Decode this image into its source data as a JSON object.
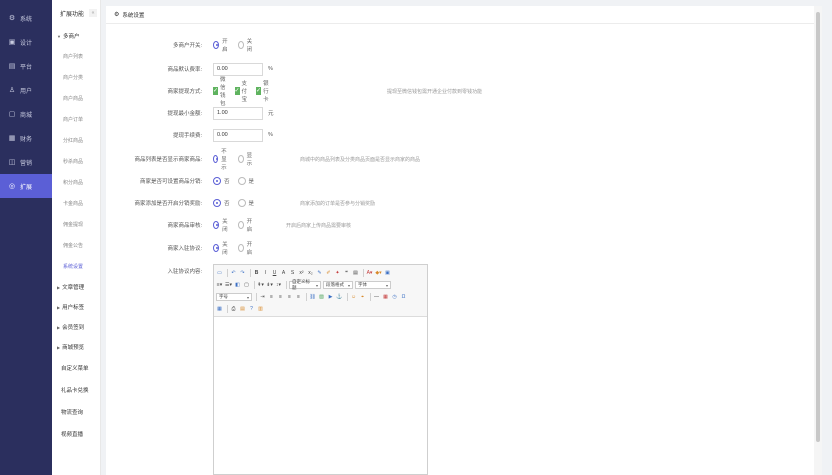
{
  "nav1": [
    {
      "icon": "⚙",
      "icon_name": "gear-icon",
      "label": "系统",
      "active": false
    },
    {
      "icon": "▣",
      "icon_name": "design-icon",
      "label": "设计",
      "active": false
    },
    {
      "icon": "▤",
      "icon_name": "platform-icon",
      "label": "平台",
      "active": false
    },
    {
      "icon": "♙",
      "icon_name": "user-icon",
      "label": "用户",
      "active": false
    },
    {
      "icon": "▢",
      "icon_name": "shop-icon",
      "label": "商城",
      "active": false
    },
    {
      "icon": "▦",
      "icon_name": "finance-icon",
      "label": "财务",
      "active": false
    },
    {
      "icon": "◫",
      "icon_name": "marketing-icon",
      "label": "营销",
      "active": false
    },
    {
      "icon": "◎",
      "icon_name": "extend-icon",
      "label": "扩展",
      "active": true
    }
  ],
  "nav2": {
    "title": "扩展功能",
    "collapse": "«",
    "multi_group": "多商户",
    "multi_items": [
      "商户列表",
      "商户分类",
      "商户商品",
      "商户订单",
      "分红商品",
      "秒杀商品",
      "积分商品",
      "卡金商品",
      "佣金提现",
      "佣金公告",
      "系统设置"
    ],
    "active_index": 10,
    "groups": [
      "文章管理",
      "用户标签",
      "会员签到",
      "商城预览"
    ],
    "tail_items": [
      "自定义菜单",
      "礼品卡兑换",
      "物流查询",
      "视频直播"
    ]
  },
  "main": {
    "title": "系统设置",
    "form": {
      "multi_label": "多商户开关:",
      "multi_on": "开启",
      "multi_off": "关闭",
      "margin_label": "商品默认费率:",
      "margin_value": "0.00",
      "margin_unit": "%",
      "withdraw_way_label": "商家提现方式:",
      "withdraw_wechat": "微信钱包",
      "withdraw_alipay": "支付宝",
      "withdraw_bank": "银行卡",
      "withdraw_tip": "提现至微信钱包需开通企业付款到零钱功能",
      "withdraw_min_label": "提现最小金额:",
      "withdraw_min_value": "1.00",
      "withdraw_min_unit": "元",
      "fee_label": "提现手续费:",
      "fee_value": "0.00",
      "fee_unit": "%",
      "show_label": "商品列表是否显示商家商品:",
      "show_no": "不显示",
      "show_yes": "显示",
      "show_tip": "商城中的商品列表及分类商品页面是否显示商家的商品",
      "direct_label": "商家是否可设置商品分销:",
      "direct_no": "否",
      "direct_yes": "是",
      "comm_label": "商家添加是否开启分销奖励:",
      "comm_no": "否",
      "comm_yes": "是",
      "comm_tip": "商家添加的订单是否参与分销奖励",
      "audit_label": "商家商品审核:",
      "audit_off": "关闭",
      "audit_on": "开启",
      "audit_tip": "开启后商家上传商品需要审核",
      "apply_label": "商家入驻协议:",
      "apply_off": "关闭",
      "apply_on": "开启",
      "agreement_label": "入驻协议内容:"
    },
    "editor": {
      "font_family": "自定义标题",
      "paragraph": "段落格式",
      "font_name": "字体",
      "font_size": "字号"
    }
  }
}
